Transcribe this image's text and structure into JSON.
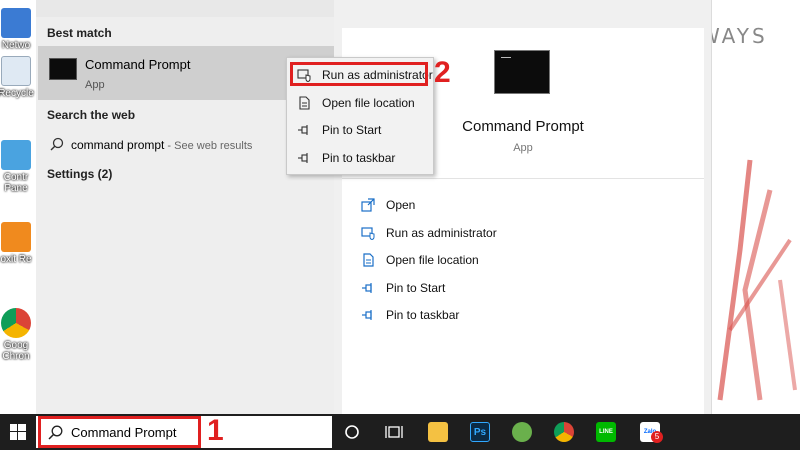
{
  "desktop": {
    "brand_text": "WAYS",
    "icons": [
      {
        "label": "Netwo"
      },
      {
        "label": "Recycle"
      },
      {
        "label": "Contr Pane"
      },
      {
        "label": "oxit Re"
      },
      {
        "label": "Goog Chron"
      }
    ]
  },
  "start_menu": {
    "best_match_header": "Best match",
    "best_match": {
      "title": "Command Prompt",
      "subtitle": "App"
    },
    "web_header": "Search the web",
    "web_result": {
      "query": "command prompt",
      "suffix": " - See web results"
    },
    "settings_header": "Settings (2)",
    "detail": {
      "title": "Command Prompt",
      "subtitle": "App",
      "actions": [
        {
          "label": "Open",
          "icon": "open-icon"
        },
        {
          "label": "Run as administrator",
          "icon": "shield-icon"
        },
        {
          "label": "Open file location",
          "icon": "file-location-icon"
        },
        {
          "label": "Pin to Start",
          "icon": "pin-icon"
        },
        {
          "label": "Pin to taskbar",
          "icon": "pin-icon"
        }
      ]
    }
  },
  "context_menu": {
    "items": [
      {
        "label": "Run as administrator",
        "icon": "shield-icon"
      },
      {
        "label": "Open file location",
        "icon": "file-location-icon"
      },
      {
        "label": "Pin to Start",
        "icon": "pin-icon"
      },
      {
        "label": "Pin to taskbar",
        "icon": "pin-icon"
      }
    ]
  },
  "annotations": {
    "step1": "1",
    "step2": "2",
    "highlight_color": "#e02020"
  },
  "taskbar": {
    "search_text": "Command Prompt",
    "apps": [
      "cortana-icon",
      "task-view-icon",
      "file-explorer-icon",
      "photoshop-icon",
      "corel-icon",
      "chrome-icon",
      "line-icon",
      "zalo-icon"
    ],
    "photoshop_label": "Ps",
    "line_label": "LINE",
    "zalo_label": "Zalo",
    "zalo_badge": "5"
  }
}
